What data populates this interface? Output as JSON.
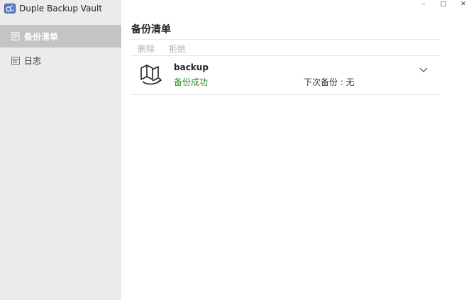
{
  "app": {
    "title": "Duple Backup Vault",
    "window_controls": {
      "minimize": "–",
      "maximize": "□",
      "close": "✕"
    }
  },
  "sidebar": {
    "items": [
      {
        "label": "备份清单",
        "icon": "list-icon",
        "active": true
      },
      {
        "label": "日志",
        "icon": "calendar-icon",
        "active": false
      }
    ]
  },
  "main": {
    "title": "备份清单",
    "toolbar": {
      "delete_label": "删除",
      "reject_label": "拒绝"
    },
    "backups": [
      {
        "name": "backup",
        "status": "备份成功",
        "next_backup": "下次备份 : 无",
        "icon": "vault-icon",
        "expand_icon": "chevron-down-icon"
      }
    ]
  },
  "colors": {
    "sidebar_bg": "#ebebeb",
    "active_item_bg": "#c4c4c4",
    "status_success": "#2e8b2e",
    "disabled_text": "#b0b0b0"
  }
}
